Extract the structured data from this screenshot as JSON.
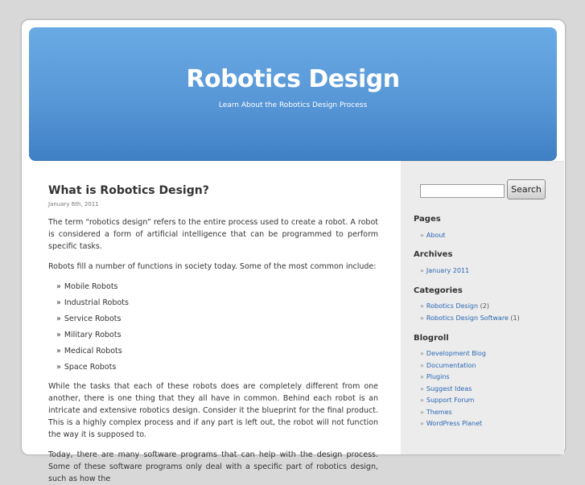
{
  "header": {
    "title": "Robotics Design",
    "tagline": "Learn About the Robotics Design Process"
  },
  "post": {
    "title": "What is Robotics Design?",
    "date": "January 6th, 2011",
    "para1": "The term “robotics design” refers to the entire process used to create a robot. A robot is considered a form of artificial intelligence that can be programmed to perform specific tasks.",
    "para2": "Robots fill a number of functions in society today. Some of the most common include:",
    "list": [
      "Mobile Robots",
      "Industrial Robots",
      "Service Robots",
      "Military Robots",
      "Medical Robots",
      "Space Robots"
    ],
    "list_bullet": "»",
    "para3": "While the tasks that each of these robots does are completely different from one another, there is one thing that they all have in common. Behind each robot is an intricate and extensive robotics design. Consider it the blueprint for the final product. This is a highly complex process and if any part is left out, the robot will not function the way it is supposed to.",
    "para4": "Today, there are many software programs that can help with the design process. Some of these software programs only deal with a specific part of robotics design, such as how the"
  },
  "sidebar": {
    "search": {
      "value": "",
      "button_label": "Search"
    },
    "bullet": "»",
    "pages": {
      "title": "Pages",
      "items": [
        "About"
      ]
    },
    "archives": {
      "title": "Archives",
      "items": [
        "January 2011"
      ]
    },
    "categories": {
      "title": "Categories",
      "items": [
        {
          "label": "Robotics Design",
          "count": "(2)"
        },
        {
          "label": "Robotics Design Software",
          "count": "(1)"
        }
      ]
    },
    "blogroll": {
      "title": "Blogroll",
      "items": [
        "Development Blog",
        "Documentation",
        "Plugins",
        "Suggest Ideas",
        "Support Forum",
        "Themes",
        "WordPress Planet"
      ]
    }
  }
}
